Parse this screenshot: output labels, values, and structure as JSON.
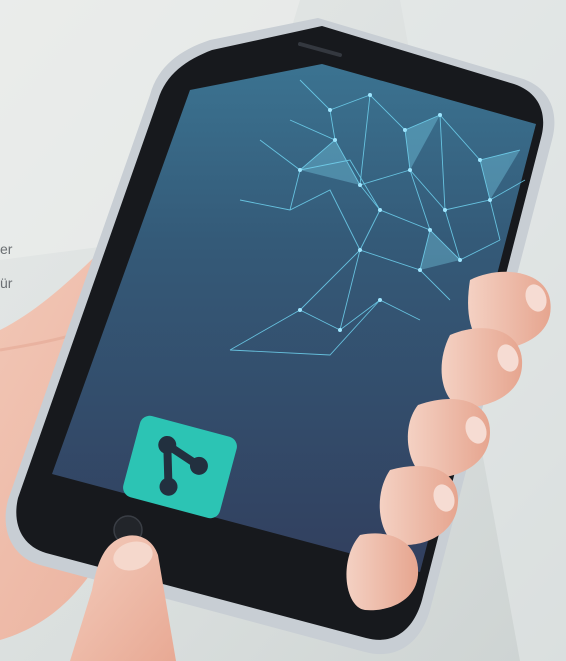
{
  "side_text": {
    "line1": "er",
    "line2": "ür"
  },
  "phone": {
    "app_icon": "share-node-icon",
    "screen_gradient_top": "#3a6e8e",
    "screen_gradient_bottom": "#334463",
    "icon_color": "#2cc4b4",
    "network_color": "#6fd3f0"
  }
}
